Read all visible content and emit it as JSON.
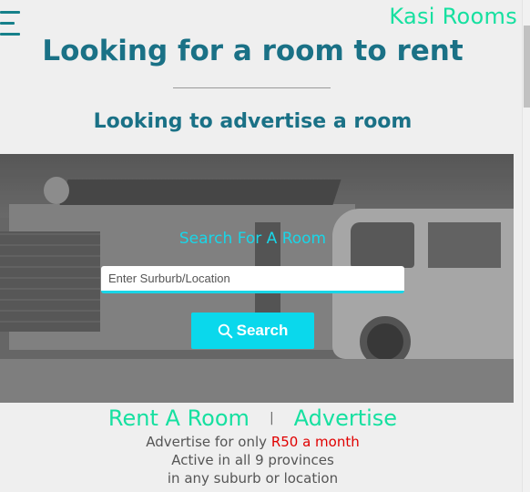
{
  "header": {
    "menu_icon": "hamburger-menu-icon",
    "brand": "Kasi Rooms"
  },
  "main": {
    "title": "Looking for a room to rent",
    "subtitle": "Looking to advertise a room"
  },
  "search": {
    "heading": "Search For A Room",
    "placeholder": "Enter Surburb/Location",
    "value": "",
    "button_label": "Search",
    "button_icon": "search-icon"
  },
  "links": {
    "rent": "Rent A Room",
    "separator": "|",
    "advertise": "Advertise"
  },
  "info": {
    "line1_prefix": "Advertise for only",
    "price": "R50 a month",
    "line2": "Active in all 9 provinces",
    "line3": "in any suburb or location"
  },
  "colors": {
    "accent": "#19d6e8",
    "brand": "#16e0a0",
    "title": "#1a7186",
    "price": "#e00000"
  }
}
